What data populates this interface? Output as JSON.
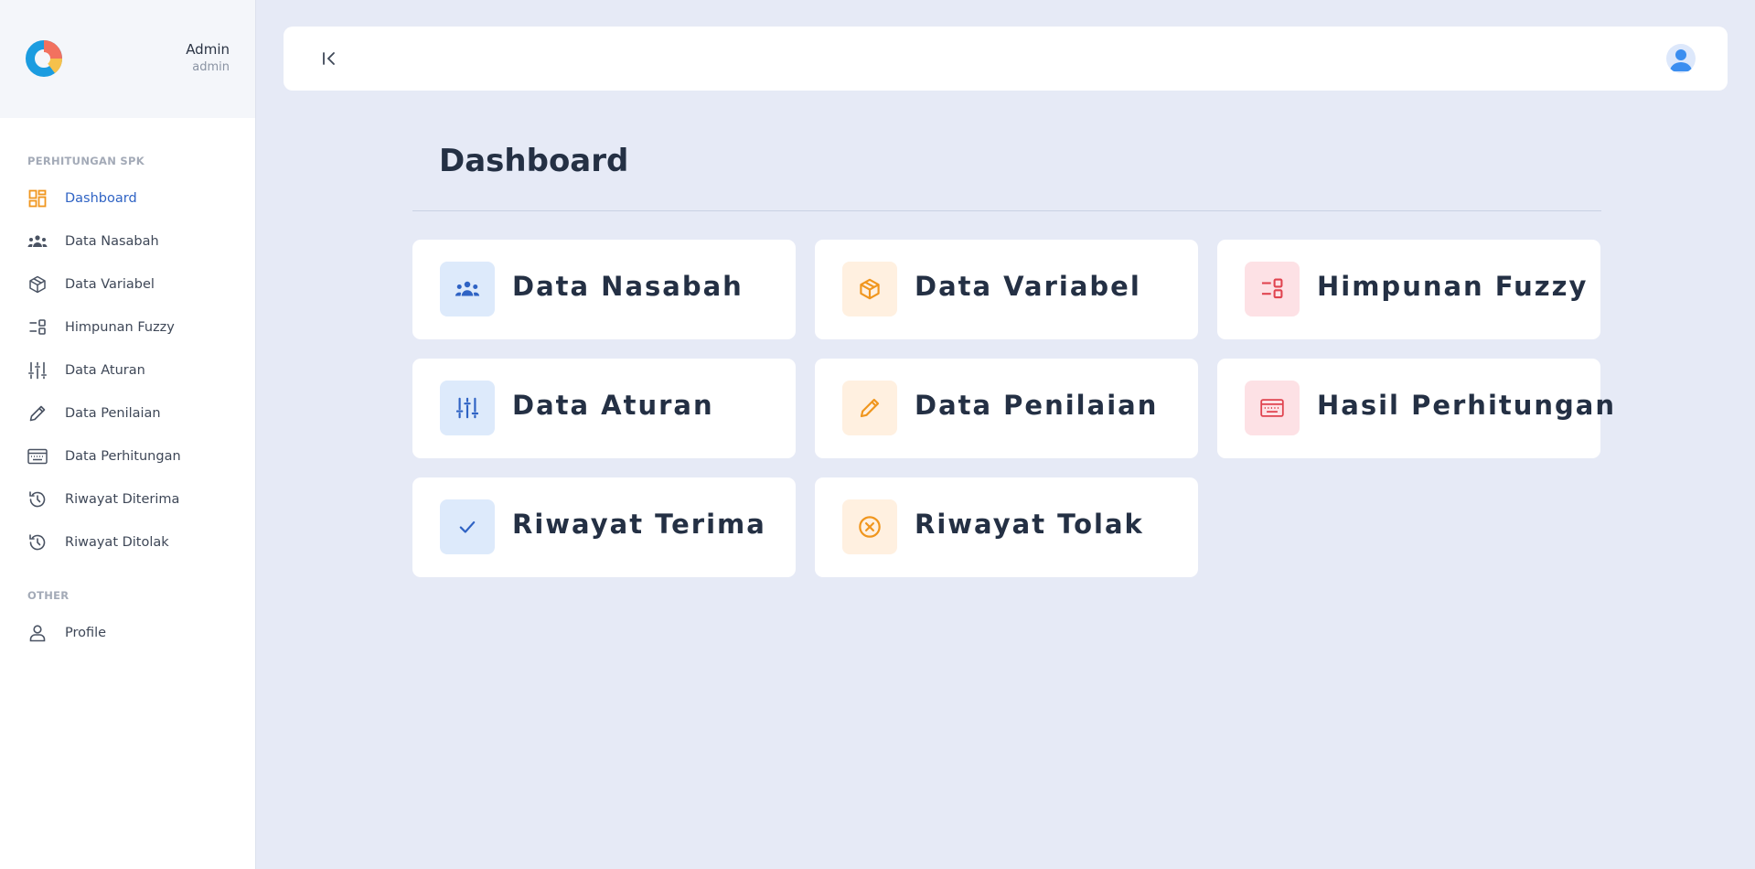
{
  "user": {
    "name": "Admin",
    "role": "admin"
  },
  "sidebar": {
    "sections": [
      {
        "title": "PERHITUNGAN SPK"
      },
      {
        "title": "OTHER"
      }
    ],
    "items": [
      {
        "label": "Dashboard",
        "icon": "dashboard-icon",
        "active": true
      },
      {
        "label": "Data Nasabah",
        "icon": "users-icon"
      },
      {
        "label": "Data Variabel",
        "icon": "cube-icon"
      },
      {
        "label": "Himpunan Fuzzy",
        "icon": "list-settings-icon"
      },
      {
        "label": "Data Aturan",
        "icon": "adjustments-icon"
      },
      {
        "label": "Data Penilaian",
        "icon": "pencil-icon"
      },
      {
        "label": "Data Perhitungan",
        "icon": "keyboard-icon"
      },
      {
        "label": "Riwayat Diterima",
        "icon": "history-icon"
      },
      {
        "label": "Riwayat Ditolak",
        "icon": "history-icon"
      },
      {
        "label": "Profile",
        "icon": "user-icon"
      }
    ]
  },
  "main": {
    "title": "Dashboard",
    "cards": [
      {
        "label": "Data Nasabah",
        "icon": "users-icon",
        "tone": "blue"
      },
      {
        "label": "Data Variabel",
        "icon": "cube-icon",
        "tone": "orange"
      },
      {
        "label": "Himpunan Fuzzy",
        "icon": "list-settings-icon",
        "tone": "red"
      },
      {
        "label": "Data Aturan",
        "icon": "adjustments-icon",
        "tone": "blue"
      },
      {
        "label": "Data Penilaian",
        "icon": "pencil-icon",
        "tone": "orange"
      },
      {
        "label": "Hasil Perhitungan",
        "icon": "keyboard-icon",
        "tone": "red"
      },
      {
        "label": "Riwayat Terima",
        "icon": "check-icon",
        "tone": "blue"
      },
      {
        "label": "Riwayat Tolak",
        "icon": "circle-x-icon",
        "tone": "orange"
      }
    ]
  },
  "colors": {
    "background": "#e6eaf6",
    "active_link": "#2f63c4",
    "icon_blue": "#2f63c4",
    "icon_orange": "#f0961e",
    "icon_red": "#e0434f"
  }
}
